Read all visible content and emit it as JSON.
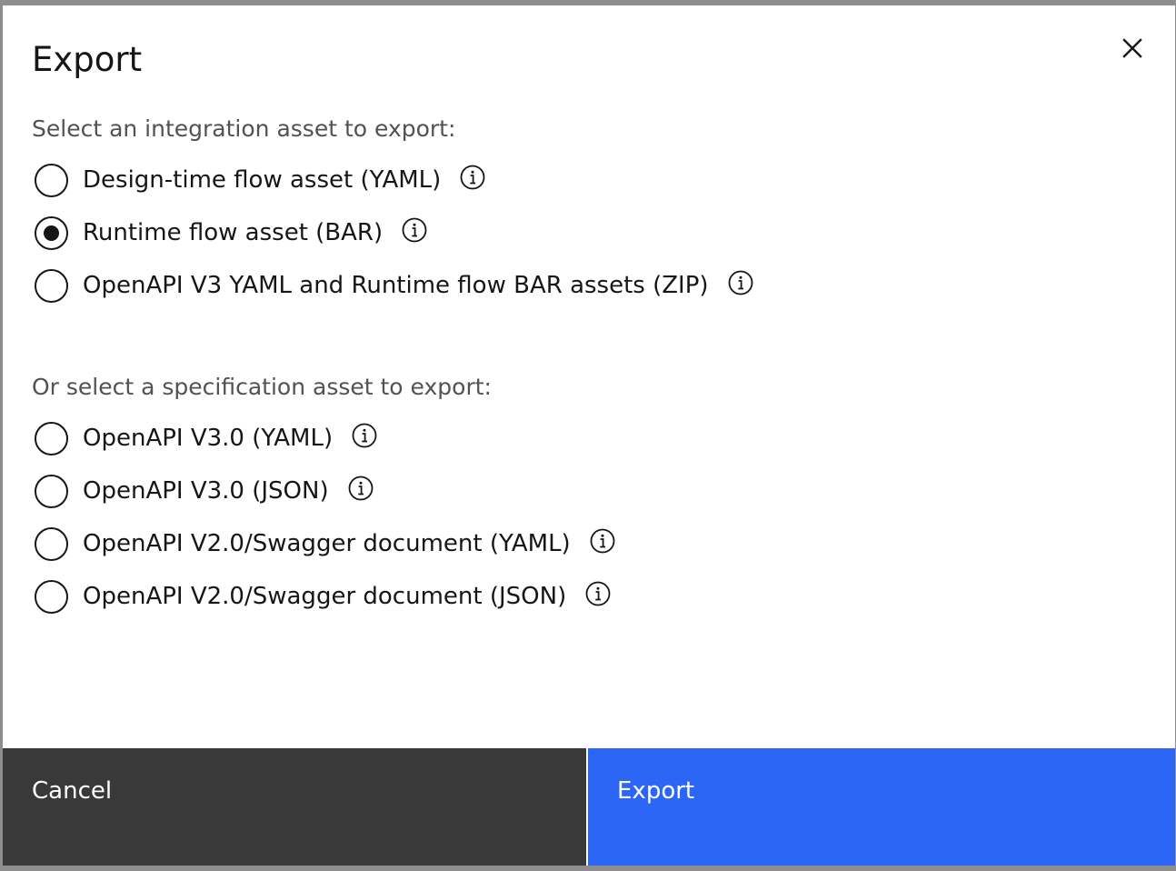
{
  "modal": {
    "title": "Export",
    "close_icon": "close-icon"
  },
  "integration": {
    "label": "Select an integration asset to export:",
    "options": [
      {
        "label": "Design-time flow asset (YAML)",
        "selected": false
      },
      {
        "label": "Runtime flow asset (BAR)",
        "selected": true
      },
      {
        "label": "OpenAPI V3 YAML and Runtime flow BAR assets (ZIP)",
        "selected": false
      }
    ]
  },
  "specification": {
    "label": "Or select a specification asset to export:",
    "options": [
      {
        "label": "OpenAPI V3.0 (YAML)",
        "selected": false
      },
      {
        "label": "OpenAPI V3.0 (JSON)",
        "selected": false
      },
      {
        "label": "OpenAPI V2.0/Swagger document (YAML)",
        "selected": false
      },
      {
        "label": "OpenAPI V2.0/Swagger document (JSON)",
        "selected": false
      }
    ]
  },
  "footer": {
    "cancel_label": "Cancel",
    "export_label": "Export"
  },
  "colors": {
    "primary": "#2b66f6",
    "secondary": "#393939",
    "text": "#161616",
    "muted_text": "#525252"
  }
}
